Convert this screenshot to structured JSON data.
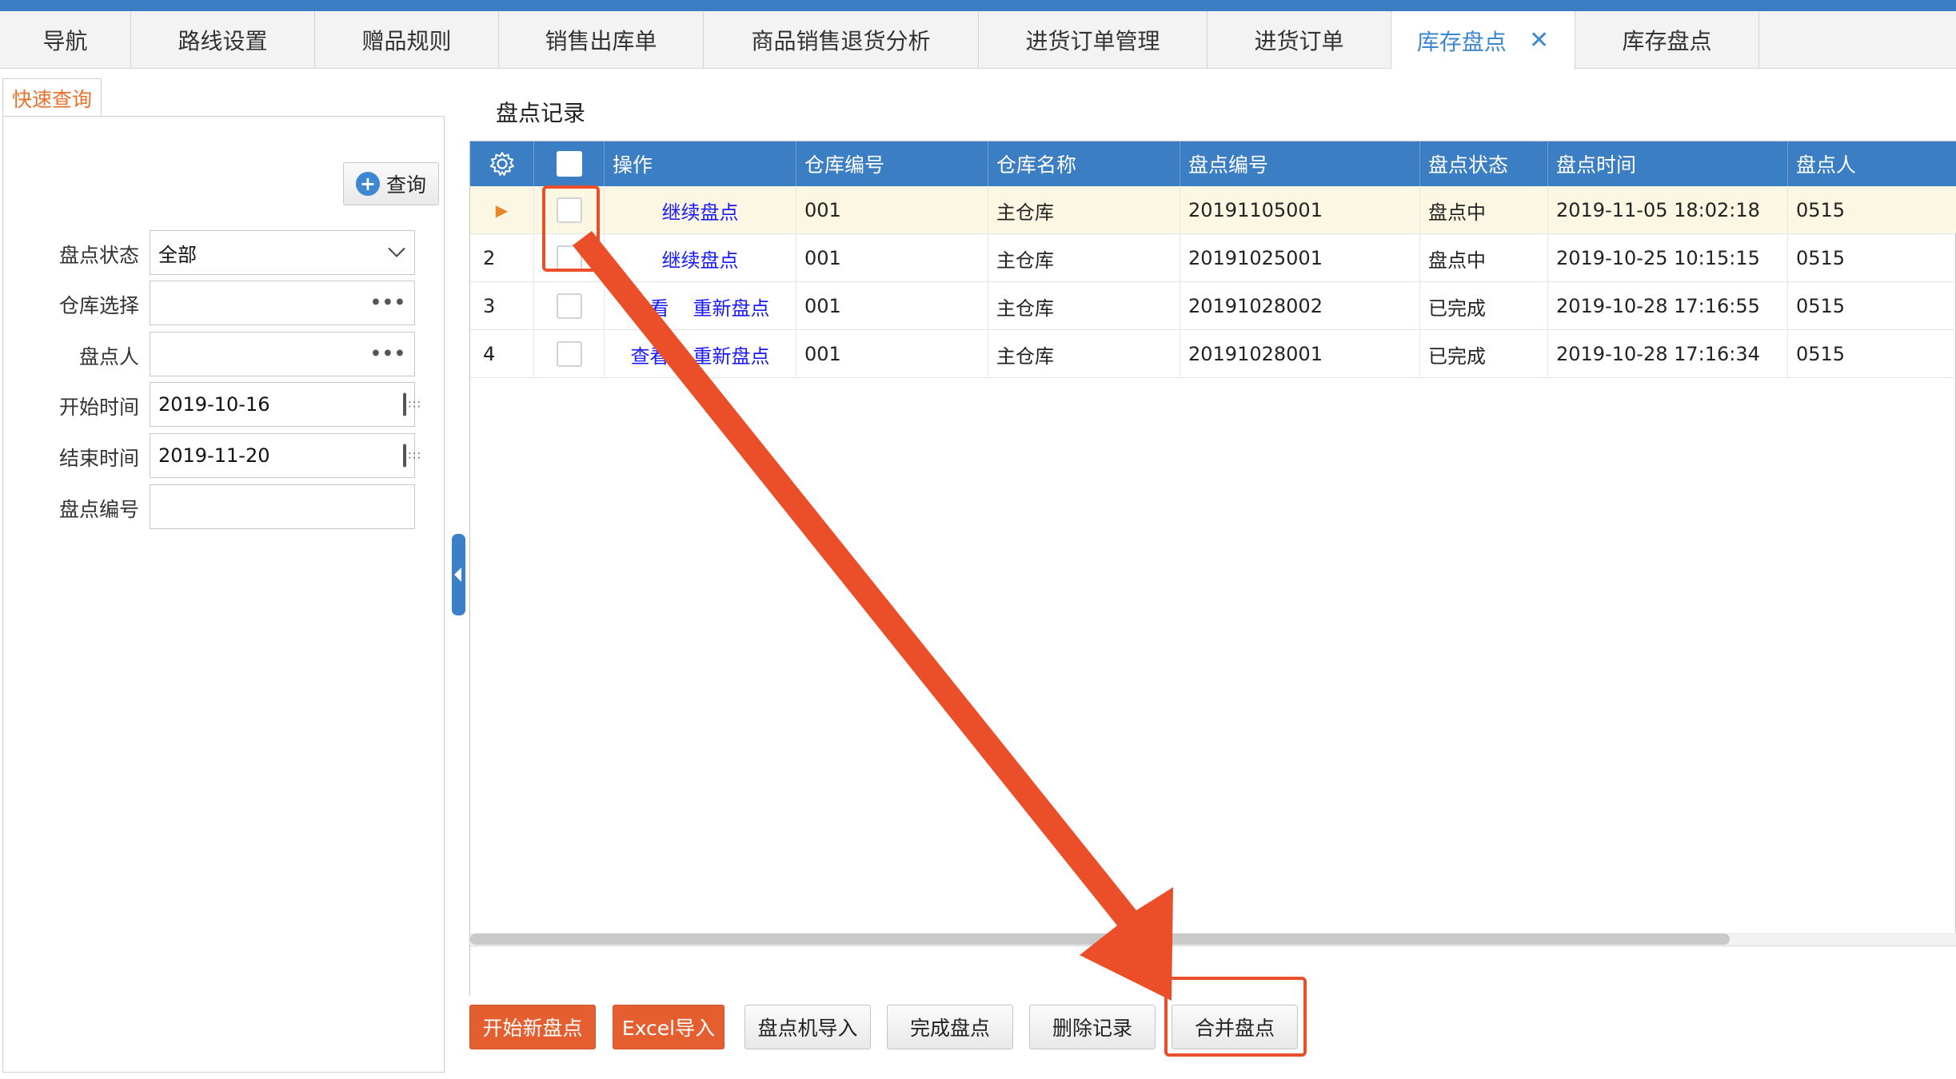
{
  "tabs": [
    {
      "label": "导航"
    },
    {
      "label": "路线设置"
    },
    {
      "label": "赠品规则"
    },
    {
      "label": "销售出库单"
    },
    {
      "label": "商品销售退货分析"
    },
    {
      "label": "进货订单管理"
    },
    {
      "label": "进货订单"
    },
    {
      "label": "库存盘点",
      "active": true,
      "close_symbol": "✕"
    },
    {
      "label": "库存盘点"
    }
  ],
  "quick_query": {
    "tab_label": "快速查询",
    "query_button": "查询",
    "fields": {
      "status": {
        "label": "盘点状态",
        "value": "全部"
      },
      "warehouse": {
        "label": "仓库选择",
        "value": ""
      },
      "counter": {
        "label": "盘点人",
        "value": ""
      },
      "start": {
        "label": "开始时间",
        "value": "2019-10-16"
      },
      "end": {
        "label": "结束时间",
        "value": "2019-11-20"
      },
      "code": {
        "label": "盘点编号",
        "value": ""
      }
    },
    "more_symbol": "•••"
  },
  "records": {
    "title": "盘点记录",
    "columns": {
      "ops": "操作",
      "wh_code": "仓库编号",
      "wh_name": "仓库名称",
      "code": "盘点编号",
      "status": "盘点状态",
      "time": "盘点时间",
      "person": "盘点人"
    },
    "rows": [
      {
        "idx": "▶",
        "actions": [
          "继续盘点"
        ],
        "wh_code": "001",
        "wh_name": "主仓库",
        "code": "20191105001",
        "status": "盘点中",
        "time": "2019-11-05 18:02:18",
        "person": "0515"
      },
      {
        "idx": "2",
        "actions": [
          "继续盘点"
        ],
        "wh_code": "001",
        "wh_name": "主仓库",
        "code": "20191025001",
        "status": "盘点中",
        "time": "2019-10-25 10:15:15",
        "person": "0515"
      },
      {
        "idx": "3",
        "actions": [
          "查看",
          "重新盘点"
        ],
        "wh_code": "001",
        "wh_name": "主仓库",
        "code": "20191028002",
        "status": "已完成",
        "time": "2019-10-28 17:16:55",
        "person": "0515"
      },
      {
        "idx": "4",
        "actions": [
          "查看",
          "重新盘点"
        ],
        "wh_code": "001",
        "wh_name": "主仓库",
        "code": "20191028001",
        "status": "已完成",
        "time": "2019-10-28 17:16:34",
        "person": "0515"
      }
    ]
  },
  "buttons": {
    "new_count": "开始新盘点",
    "excel_import": "Excel导入",
    "device_import": "盘点机导入",
    "finish": "完成盘点",
    "delete": "删除记录",
    "merge": "合并盘点"
  },
  "colors": {
    "header_blue": "#3c7ec4",
    "accent_orange": "#e55e2f",
    "annotation_red": "#ea4f2a",
    "link_blue": "#1a1aff"
  }
}
